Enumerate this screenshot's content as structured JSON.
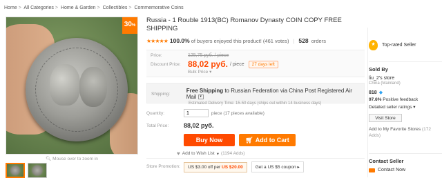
{
  "breadcrumb": [
    "Home",
    "All Categories",
    "Home & Garden",
    "Collectibles",
    "Commemorative Coins"
  ],
  "gallery": {
    "badge_value": "30",
    "badge_unit": "%",
    "zoom_hint": "Mouse over to zoom in"
  },
  "product": {
    "title": "Russia - 1 Rouble 1913(BC) Romanov Dynasty COIN COPY FREE SHIPPING",
    "stars": "★★★★★",
    "positive_percent": "100.0%",
    "positive_text": "of buyers enjoyed this product! (461 votes)",
    "orders_count": "528",
    "orders_label": "orders"
  },
  "pricing": {
    "price_label": "Price:",
    "old_price": "125,75 руб. / piece",
    "discount_label": "Discount Price:",
    "discount_price": "88,02 руб.",
    "per_piece": "/ piece",
    "days_left": "27 days left",
    "bulk_price": "Bulk Price ▾"
  },
  "shipping": {
    "label": "Shipping:",
    "free": "Free Shipping",
    "to_text": " to  Russian Federation via China Post Registered Air Mail",
    "delivery": "Estimated Delivery Time: 15-50 days (ships out within 14 business days)"
  },
  "quantity": {
    "label": "Quantity:",
    "value": "1",
    "note": "piece (17 pieces available)"
  },
  "total": {
    "label": "Total Price:",
    "value": "88,02 руб."
  },
  "actions": {
    "buy_now": "Buy Now",
    "add_to_cart": "Add to Cart",
    "wishlist": "Add to Wish List",
    "wishlist_adds": "(1194 Adds)"
  },
  "promotion": {
    "label": "Store Promotion:",
    "coupon1_prefix": "US $3.00 off per ",
    "coupon1_amount": "US $20.00",
    "coupon2": "Get a US $5 coupon ▸"
  },
  "sidebar": {
    "top_rated": "Top-rated Seller",
    "sold_by": "Sold By",
    "store_name": "liu_2's store",
    "store_location": "China (Mainland)",
    "score": "818",
    "positive_feedback_pct": "97.6%",
    "positive_feedback_text": "Positive feedback",
    "detailed_ratings": "Detailed seller ratings ▾",
    "visit_store": "Visit Store",
    "add_favorite": "Add to My Favorite Stores",
    "favorite_count": "(172 Adds)",
    "contact_title": "Contact Seller",
    "contact_now": "Contact Now"
  },
  "colors": {
    "accent_orange": "#ff7a00",
    "buy_red": "#ff4a00"
  }
}
